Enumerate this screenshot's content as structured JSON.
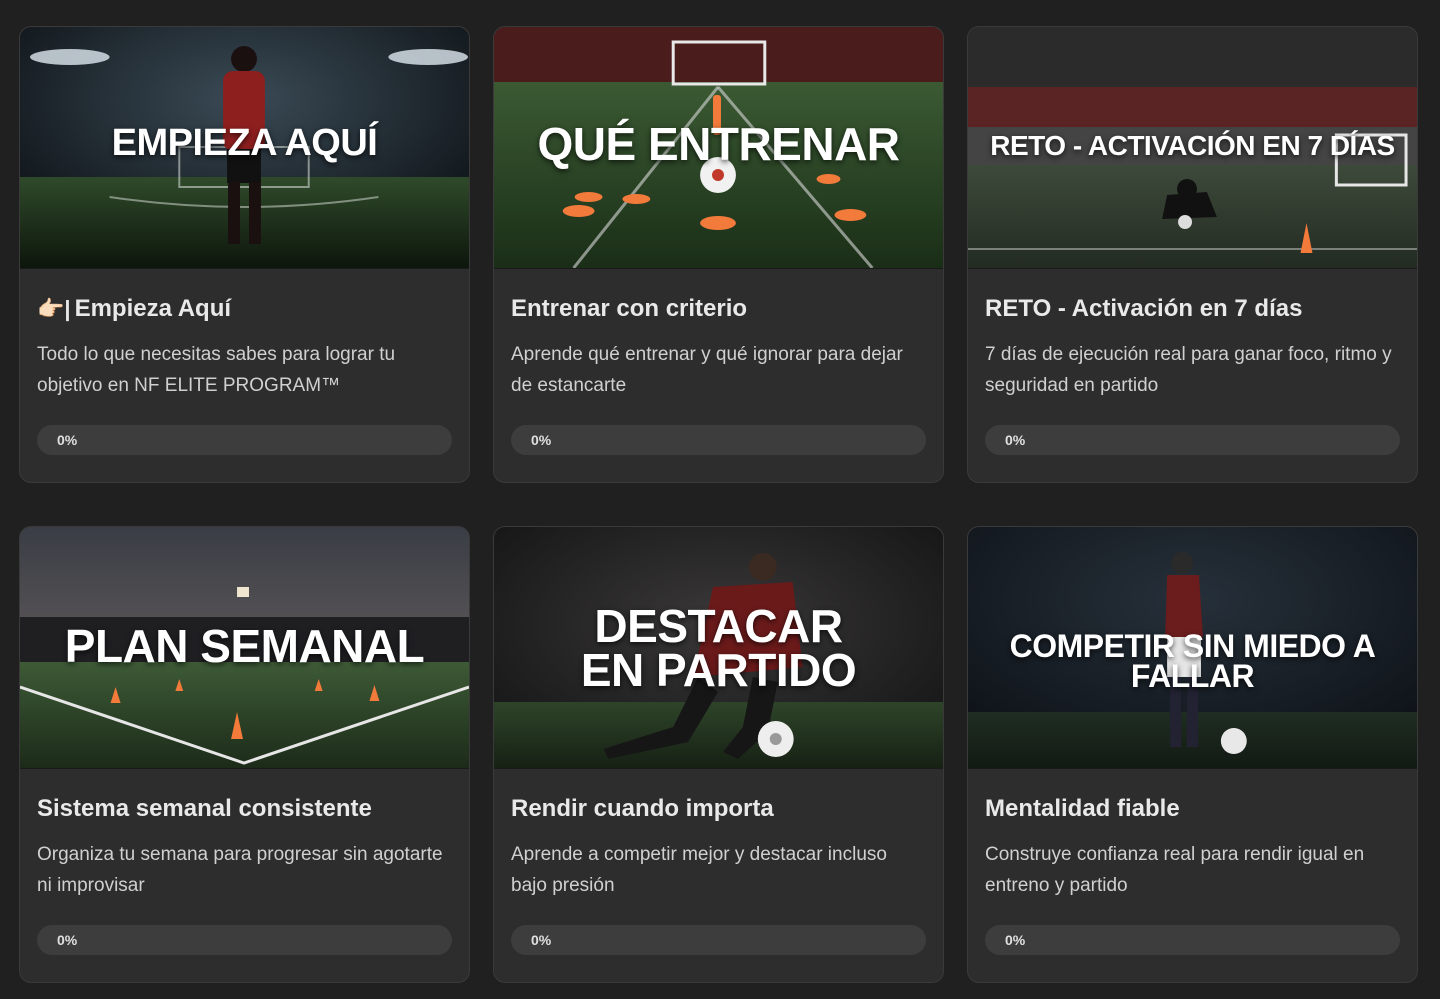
{
  "cards": [
    {
      "banner": "EMPIEZA AQUÍ",
      "icon": "pointing-hand-icon",
      "icon_glyph": "👉🏻|",
      "title": "Empieza Aquí",
      "description": "Todo lo que necesitas sabes para lograr tu objetivo en NF ELITE PROGRAM™",
      "progress_label": "0%",
      "progress": 0
    },
    {
      "banner": "QUÉ ENTRENAR",
      "title": "Entrenar con criterio",
      "description": "Aprende qué entrenar y qué ignorar para dejar de estancarte",
      "progress_label": "0%",
      "progress": 0
    },
    {
      "banner": "RETO - ACTIVACIÓN EN 7 DÍAS",
      "title": "RETO - Activación en 7 días",
      "description": "7 días de ejecución real para ganar foco, ritmo y seguridad en partido",
      "progress_label": "0%",
      "progress": 0
    },
    {
      "banner": "PLAN SEMANAL",
      "title": "Sistema semanal consistente",
      "description": "Organiza tu semana para progresar sin agotarte ni improvisar",
      "progress_label": "0%",
      "progress": 0
    },
    {
      "banner": "DESTACAR\nEN PARTIDO",
      "title": "Rendir cuando importa",
      "description": "Aprende a competir mejor y destacar incluso bajo presión",
      "progress_label": "0%",
      "progress": 0
    },
    {
      "banner": "COMPETIR SIN MIEDO A FALLAR",
      "title": "Mentalidad fiable",
      "description": "Construye confianza real para rendir igual en entreno y partido",
      "progress_label": "0%",
      "progress": 0
    }
  ],
  "colors": {
    "background": "#202020",
    "card": "#2d2d2d",
    "progress_track": "#3d3d3d"
  }
}
